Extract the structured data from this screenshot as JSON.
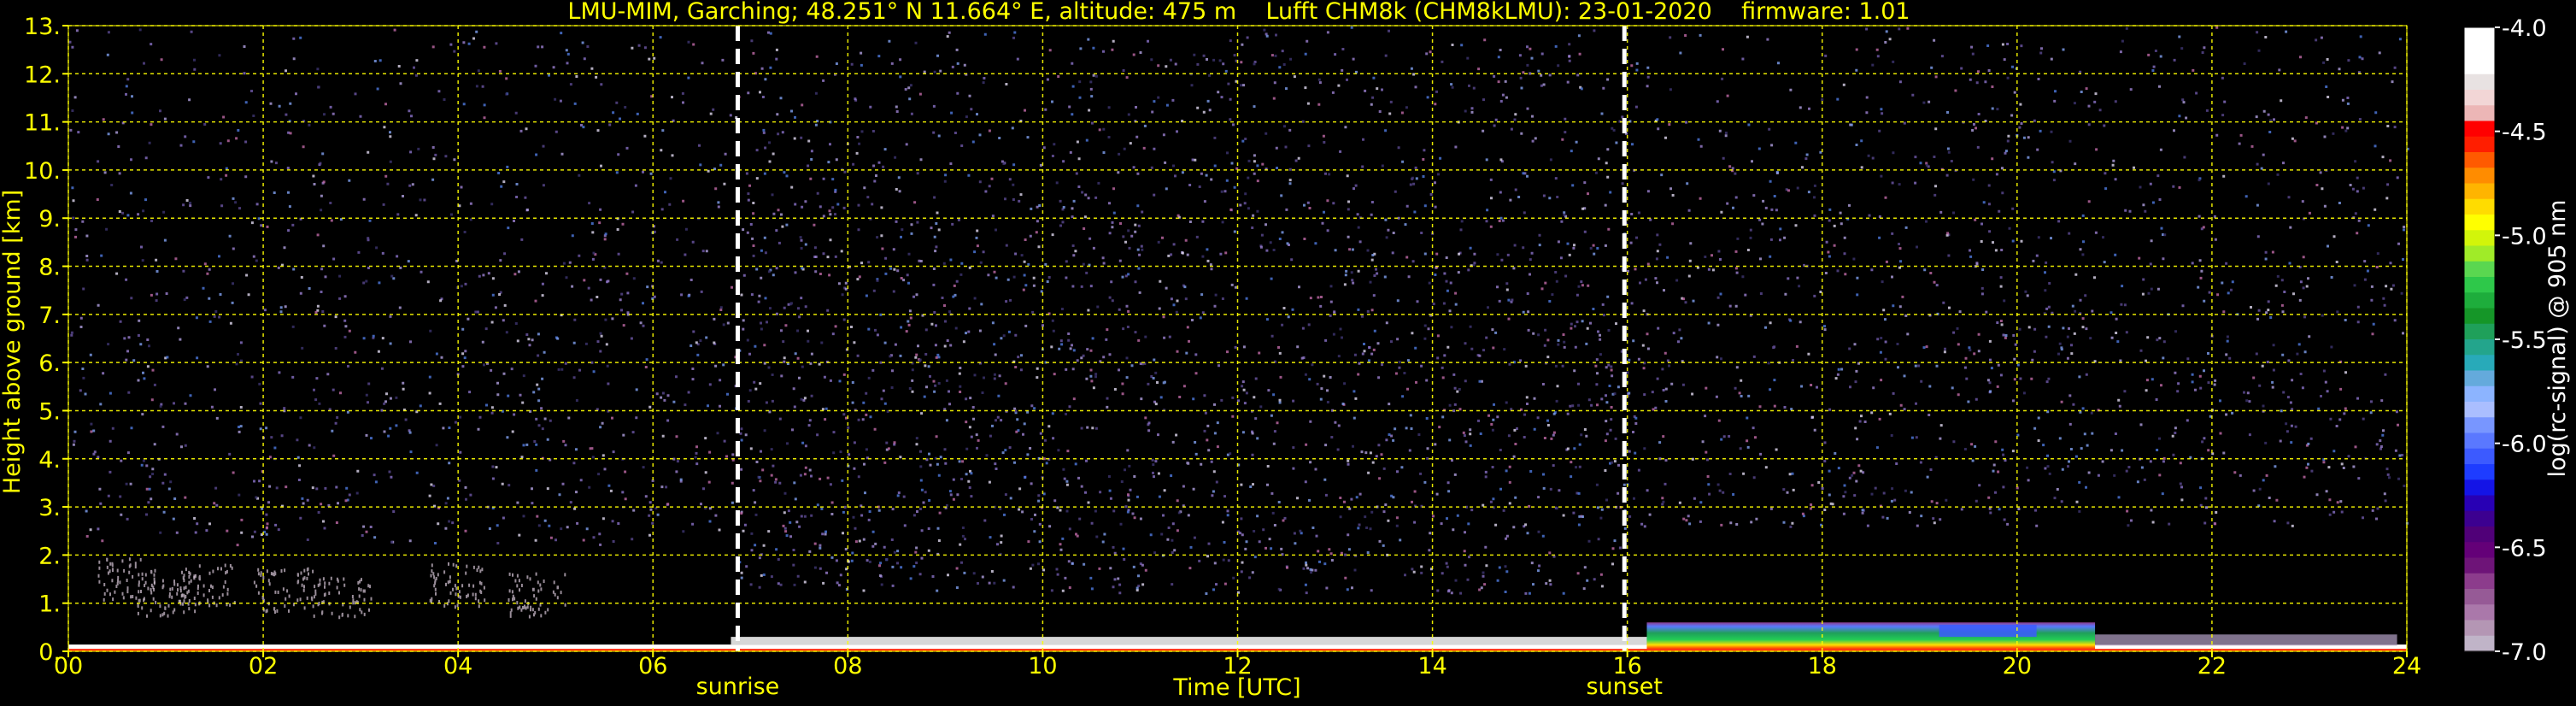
{
  "chart_data": {
    "type": "heatmap",
    "title": "LMU-MIM, Garching; 48.251° N 11.664° E, altitude: 475 m    Lufft CHM8k (CHM8kLMU): 23-01-2020    firmware: 1.01",
    "xlabel": "Time [UTC]",
    "ylabel": "Height above ground [km]",
    "xlim": [
      0,
      24
    ],
    "ylim": [
      0,
      13
    ],
    "x_ticks": [
      0,
      2,
      4,
      6,
      8,
      10,
      12,
      14,
      16,
      18,
      20,
      22,
      24
    ],
    "x_tick_labels": [
      "00",
      "02",
      "04",
      "06",
      "08",
      "10",
      "12",
      "14",
      "16",
      "18",
      "20",
      "22",
      "24"
    ],
    "y_ticks": [
      0,
      1,
      2,
      3,
      4,
      5,
      6,
      7,
      8,
      9,
      10,
      11,
      12,
      13
    ],
    "y_tick_labels": [
      "0.",
      "1.",
      "2.",
      "3.",
      "4.",
      "5.",
      "6.",
      "7.",
      "8.",
      "9.",
      "10.",
      "11.",
      "12.",
      "13."
    ],
    "grid": true,
    "vertical_markers": [
      {
        "label": "sunrise",
        "x": 6.87
      },
      {
        "label": "sunset",
        "x": 15.97
      }
    ],
    "colorbar": {
      "label": "log(rc-signal) @ 905 nm",
      "range": [
        -7.0,
        -4.0
      ],
      "ticks": [
        -4.0,
        -4.5,
        -5.0,
        -5.5,
        -6.0,
        -6.5,
        -7.0
      ],
      "tick_labels": [
        "-4.0",
        "-4.5",
        "-5.0",
        "-5.5",
        "-6.0",
        "-6.5",
        "-7.0"
      ],
      "colors": [
        "#ffffff",
        "#ffffff",
        "#ffffff",
        "#e8e2e2",
        "#f2d6d6",
        "#ecb6b6",
        "#ff0000",
        "#ff1e00",
        "#ff5a00",
        "#ff8c00",
        "#ffb400",
        "#ffdc00",
        "#ffff00",
        "#d2f50a",
        "#a0eb28",
        "#5ad750",
        "#2ec84a",
        "#1ead3c",
        "#159628",
        "#1fa05a",
        "#23a58c",
        "#28aab9",
        "#64aadc",
        "#8cb4ff",
        "#aabeff",
        "#7896ff",
        "#5a78ff",
        "#3c5aff",
        "#1e3cff",
        "#1414e6",
        "#2800b4",
        "#3c0090",
        "#500078",
        "#640078",
        "#6e1478",
        "#8c3c8c",
        "#965a96",
        "#aa78aa",
        "#b496b4",
        "#c0b4c8"
      ]
    },
    "background_signal": {
      "noise_color": "#6e58a8",
      "noise_bands": [
        {
          "x0": 0,
          "x1": 6.87,
          "y0": 2.2,
          "y1": 13,
          "level": 0.55
        },
        {
          "x0": 6.87,
          "x1": 15.97,
          "y0": 1.2,
          "y1": 13,
          "level": 0.85
        },
        {
          "x0": 15.97,
          "x1": 24,
          "y0": 2.6,
          "y1": 13,
          "level": 0.6
        }
      ],
      "aerosol_layer": {
        "x0": 16.2,
        "x1": 20.8,
        "y0": 0.05,
        "y1": 0.6
      }
    }
  }
}
